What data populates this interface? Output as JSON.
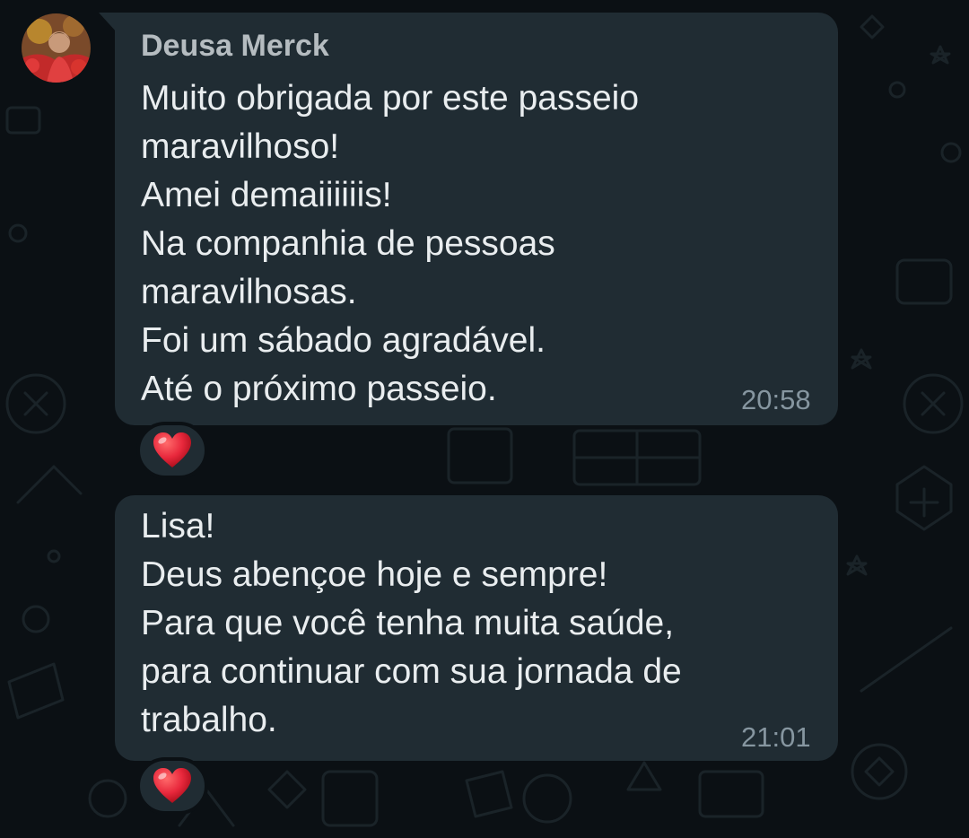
{
  "chat": {
    "messages": [
      {
        "sender": "Deusa Merck",
        "lines": [
          "Muito obrigada por este passeio",
          "maravilhoso!",
          "Amei demaiiiiiis!",
          "Na companhia de pessoas",
          "maravilhosas.",
          "Foi um sábado agradável.",
          "Até o próximo passeio."
        ],
        "time": "20:58",
        "reaction": "heart-emoji"
      },
      {
        "lines": [
          "Lisa!",
          "Deus abençoe hoje e sempre!",
          "Para que você tenha muita saúde,",
          "para continuar com sua jornada de",
          "trabalho."
        ],
        "time": "21:01",
        "reaction": "heart-emoji"
      }
    ]
  },
  "colors": {
    "background": "#0b1014",
    "bubble": "#202c33",
    "text": "#e9edef",
    "meta": "#8696a0",
    "heart": "#e8283c"
  }
}
